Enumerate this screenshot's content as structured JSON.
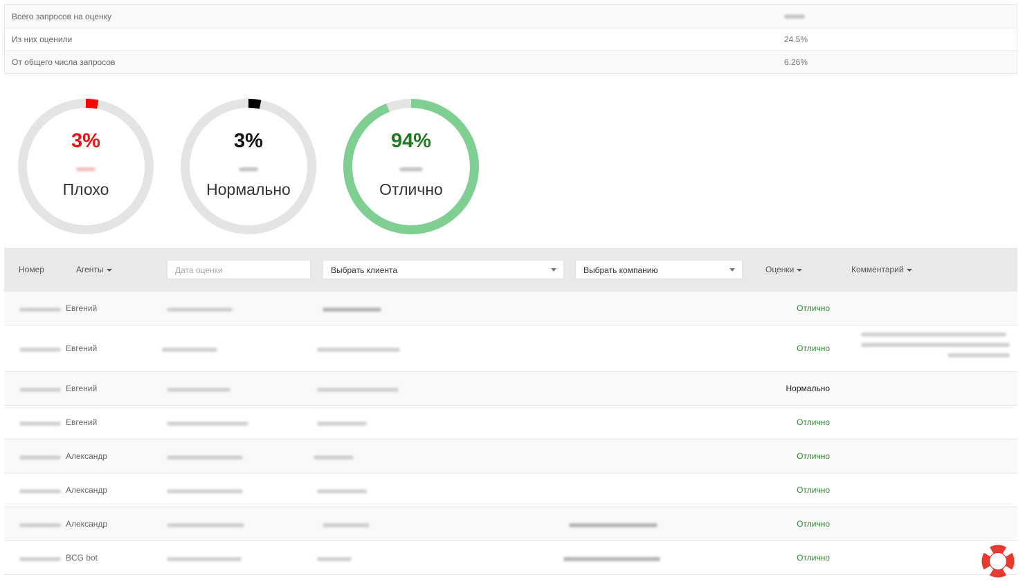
{
  "stats": [
    {
      "label": "Всего запросов на оценку",
      "value": ""
    },
    {
      "label": "Из них оценили",
      "value": "24.5%"
    },
    {
      "label": "От общего числа запросов",
      "value": "6.26%"
    }
  ],
  "ratings": [
    {
      "percent_text": "3%",
      "label": "Плохо",
      "fraction": 0.03,
      "color": "#ff0000",
      "text_color": "#ee1111"
    },
    {
      "percent_text": "3%",
      "label": "Нормально",
      "fraction": 0.03,
      "color": "#000000",
      "text_color": "#111111"
    },
    {
      "percent_text": "94%",
      "label": "Отлично",
      "fraction": 0.94,
      "color": "#7fcf93",
      "text_color": "#1f7a1f"
    }
  ],
  "table": {
    "headers": {
      "number": "Номер",
      "agents": "Агенты",
      "comments_col": "Комментарий",
      "ratings_col": "Оценки"
    },
    "filters": {
      "date_placeholder": "Дата оценки",
      "client_select": "Выбрать клиента",
      "company_select": "Выбрать компанию"
    },
    "rows": [
      {
        "agent": "Евгений",
        "rating": "Отлично",
        "kind": "good"
      },
      {
        "agent": "Евгений",
        "rating": "Отлично",
        "kind": "good"
      },
      {
        "agent": "Евгений",
        "rating": "Нормально",
        "kind": "normal"
      },
      {
        "agent": "Евгений",
        "rating": "Отлично",
        "kind": "good"
      },
      {
        "agent": "Александр",
        "rating": "Отлично",
        "kind": "good"
      },
      {
        "agent": "Александр",
        "rating": "Отлично",
        "kind": "good"
      },
      {
        "agent": "Александр",
        "rating": "Отлично",
        "kind": "good"
      },
      {
        "agent": "BCG bot",
        "rating": "Отлично",
        "kind": "good"
      }
    ]
  },
  "help": {
    "icon": "lifebuoy-icon",
    "color": "#e83a2f"
  }
}
